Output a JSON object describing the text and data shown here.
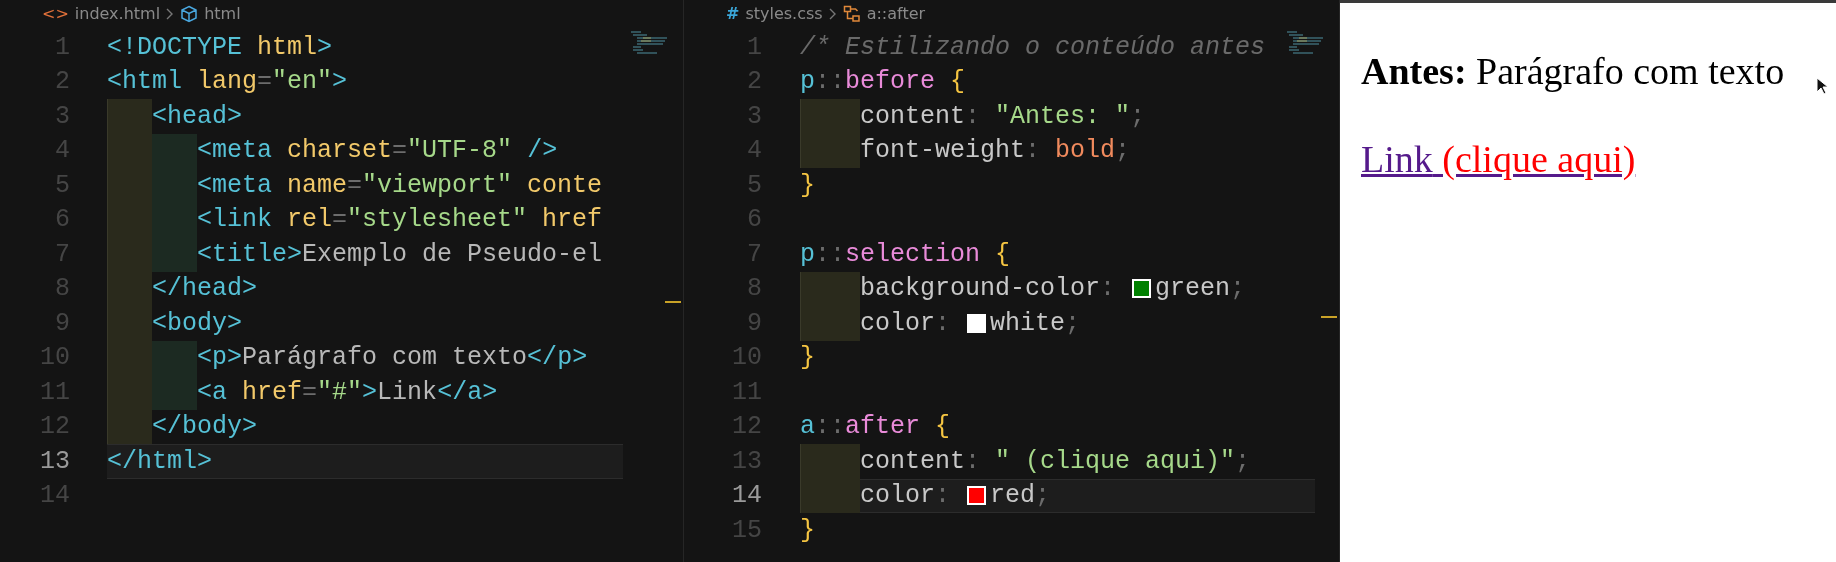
{
  "editors": [
    {
      "breadcrumb": {
        "file_icon": "<>",
        "file": "index.html",
        "symbol": "html",
        "kind": "markup"
      },
      "lines": [
        {
          "number": "1",
          "current": false,
          "tokens": [
            {
              "kind": "tag",
              "text": "<!"
            },
            {
              "kind": "tagname",
              "text": "DOCTYPE"
            },
            {
              "kind": "attr",
              "text": " html"
            },
            {
              "kind": "tag",
              "text": ">"
            }
          ]
        },
        {
          "number": "2",
          "current": false,
          "tokens": [
            {
              "kind": "tag",
              "text": "<"
            },
            {
              "kind": "tagname",
              "text": "html"
            },
            {
              "kind": "attr",
              "text": " lang"
            },
            {
              "kind": "punct",
              "text": "="
            },
            {
              "kind": "string",
              "text": "\"en\""
            },
            {
              "kind": "tag",
              "text": ">"
            }
          ]
        },
        {
          "number": "3",
          "current": false,
          "tokens": [
            {
              "kind": "tag",
              "text": "   <"
            },
            {
              "kind": "tagname",
              "text": "head"
            },
            {
              "kind": "tag",
              "text": ">"
            }
          ]
        },
        {
          "number": "4",
          "current": false,
          "tokens": [
            {
              "kind": "tag",
              "text": "      <"
            },
            {
              "kind": "tagname",
              "text": "meta"
            },
            {
              "kind": "attr",
              "text": " charset"
            },
            {
              "kind": "punct",
              "text": "="
            },
            {
              "kind": "string",
              "text": "\"UTF-8\""
            },
            {
              "kind": "tag",
              "text": " />"
            }
          ]
        },
        {
          "number": "5",
          "current": false,
          "tokens": [
            {
              "kind": "tag",
              "text": "      <"
            },
            {
              "kind": "tagname",
              "text": "meta"
            },
            {
              "kind": "attr",
              "text": " name"
            },
            {
              "kind": "punct",
              "text": "="
            },
            {
              "kind": "string",
              "text": "\"viewport\""
            },
            {
              "kind": "attr",
              "text": " conte"
            }
          ]
        },
        {
          "number": "6",
          "current": false,
          "tokens": [
            {
              "kind": "tag",
              "text": "      <"
            },
            {
              "kind": "tagname",
              "text": "link"
            },
            {
              "kind": "attr",
              "text": " rel"
            },
            {
              "kind": "punct",
              "text": "="
            },
            {
              "kind": "string",
              "text": "\"stylesheet\""
            },
            {
              "kind": "attr",
              "text": " href"
            }
          ]
        },
        {
          "number": "7",
          "current": false,
          "tokens": [
            {
              "kind": "tag",
              "text": "      <"
            },
            {
              "kind": "tagname",
              "text": "title"
            },
            {
              "kind": "tag",
              "text": ">"
            },
            {
              "kind": "text",
              "text": "Exemplo de Pseudo-el"
            }
          ]
        },
        {
          "number": "8",
          "current": false,
          "tokens": [
            {
              "kind": "tag",
              "text": "   </"
            },
            {
              "kind": "tagname",
              "text": "head"
            },
            {
              "kind": "tag",
              "text": ">"
            }
          ]
        },
        {
          "number": "9",
          "current": false,
          "tokens": [
            {
              "kind": "tag",
              "text": "   <"
            },
            {
              "kind": "tagname",
              "text": "body"
            },
            {
              "kind": "tag",
              "text": ">"
            }
          ]
        },
        {
          "number": "10",
          "current": false,
          "tokens": [
            {
              "kind": "tag",
              "text": "      <"
            },
            {
              "kind": "tagname",
              "text": "p"
            },
            {
              "kind": "tag",
              "text": ">"
            },
            {
              "kind": "text",
              "text": "Parágrafo com texto"
            },
            {
              "kind": "tag",
              "text": "</"
            },
            {
              "kind": "tagname",
              "text": "p"
            },
            {
              "kind": "tag",
              "text": ">"
            }
          ]
        },
        {
          "number": "11",
          "current": false,
          "tokens": [
            {
              "kind": "tag",
              "text": "      <"
            },
            {
              "kind": "tagname",
              "text": "a"
            },
            {
              "kind": "attr",
              "text": " href"
            },
            {
              "kind": "punct",
              "text": "="
            },
            {
              "kind": "string",
              "text": "\"#\""
            },
            {
              "kind": "tag",
              "text": ">"
            },
            {
              "kind": "text",
              "text": "Link"
            },
            {
              "kind": "tag",
              "text": "</"
            },
            {
              "kind": "tagname",
              "text": "a"
            },
            {
              "kind": "tag",
              "text": ">"
            }
          ]
        },
        {
          "number": "12",
          "current": false,
          "tokens": [
            {
              "kind": "tag",
              "text": "   </"
            },
            {
              "kind": "tagname",
              "text": "body"
            },
            {
              "kind": "tag",
              "text": ">"
            }
          ]
        },
        {
          "number": "13",
          "current": true,
          "tokens": [
            {
              "kind": "tag",
              "text": "</"
            },
            {
              "kind": "tagname",
              "text": "html"
            },
            {
              "kind": "tag",
              "text": ">"
            }
          ]
        },
        {
          "number": "14",
          "current": false
        }
      ]
    },
    {
      "breadcrumb": {
        "file_icon": "#",
        "file": "styles.css",
        "symbol": "a::after",
        "kind": "stylesheet"
      },
      "lines": [
        {
          "number": "1",
          "current": false,
          "tokens": [
            {
              "kind": "comment",
              "text": "/* Estilizando o conteúdo antes"
            }
          ]
        },
        {
          "number": "2",
          "current": false,
          "tokens": [
            {
              "kind": "selector",
              "text": "p"
            },
            {
              "kind": "punct",
              "text": "::"
            },
            {
              "kind": "pseudo",
              "text": "before"
            },
            {
              "kind": "brace",
              "text": " {"
            }
          ]
        },
        {
          "number": "3",
          "current": false,
          "tokens": [
            {
              "kind": "prop",
              "text": "    content"
            },
            {
              "kind": "punct",
              "text": ": "
            },
            {
              "kind": "string",
              "text": "\"Antes: \""
            },
            {
              "kind": "punct",
              "text": ";"
            }
          ]
        },
        {
          "number": "4",
          "current": false,
          "tokens": [
            {
              "kind": "prop",
              "text": "    font-weight"
            },
            {
              "kind": "punct",
              "text": ": "
            },
            {
              "kind": "value",
              "text": "bold"
            },
            {
              "kind": "punct",
              "text": ";"
            }
          ]
        },
        {
          "number": "5",
          "current": false,
          "tokens": [
            {
              "kind": "brace",
              "text": "}"
            }
          ]
        },
        {
          "number": "6",
          "current": false
        },
        {
          "number": "7",
          "current": false,
          "tokens": [
            {
              "kind": "selector",
              "text": "p"
            },
            {
              "kind": "punct",
              "text": "::"
            },
            {
              "kind": "pseudo",
              "text": "selection"
            },
            {
              "kind": "brace",
              "text": " {"
            }
          ]
        },
        {
          "number": "8",
          "current": false,
          "tokens": [
            {
              "kind": "prop",
              "text": "    background-color"
            },
            {
              "kind": "punct",
              "text": ": "
            },
            {
              "kind": "swatch",
              "color": "#008000"
            },
            {
              "kind": "prop",
              "text": "green"
            },
            {
              "kind": "punct",
              "text": ";"
            }
          ]
        },
        {
          "number": "9",
          "current": false,
          "tokens": [
            {
              "kind": "prop",
              "text": "    color"
            },
            {
              "kind": "punct",
              "text": ": "
            },
            {
              "kind": "swatch",
              "color": "#ffffff"
            },
            {
              "kind": "prop",
              "text": "white"
            },
            {
              "kind": "punct",
              "text": ";"
            }
          ]
        },
        {
          "number": "10",
          "current": false,
          "tokens": [
            {
              "kind": "brace",
              "text": "}"
            }
          ]
        },
        {
          "number": "11",
          "current": false
        },
        {
          "number": "12",
          "current": false,
          "tokens": [
            {
              "kind": "selector",
              "text": "a"
            },
            {
              "kind": "punct",
              "text": "::"
            },
            {
              "kind": "pseudo",
              "text": "after"
            },
            {
              "kind": "brace",
              "text": " {"
            }
          ]
        },
        {
          "number": "13",
          "current": false,
          "tokens": [
            {
              "kind": "prop",
              "text": "    content"
            },
            {
              "kind": "punct",
              "text": ": "
            },
            {
              "kind": "string",
              "text": "\" (clique aqui)\""
            },
            {
              "kind": "punct",
              "text": ";"
            }
          ]
        },
        {
          "number": "14",
          "current": true,
          "tokens": [
            {
              "kind": "prop",
              "text": "    color"
            },
            {
              "kind": "punct",
              "text": ": "
            },
            {
              "kind": "swatch",
              "color": "#ff0000"
            },
            {
              "kind": "prop",
              "text": "red"
            },
            {
              "kind": "punct",
              "text": ";"
            }
          ]
        },
        {
          "number": "15",
          "current": false,
          "tokens": [
            {
              "kind": "brace",
              "text": "}"
            }
          ]
        }
      ]
    }
  ],
  "preview": {
    "paragraph": "**Antes:** Parágrafo com texto",
    "link": {
      "text": "Link",
      "after": " (clique aqui)"
    }
  }
}
